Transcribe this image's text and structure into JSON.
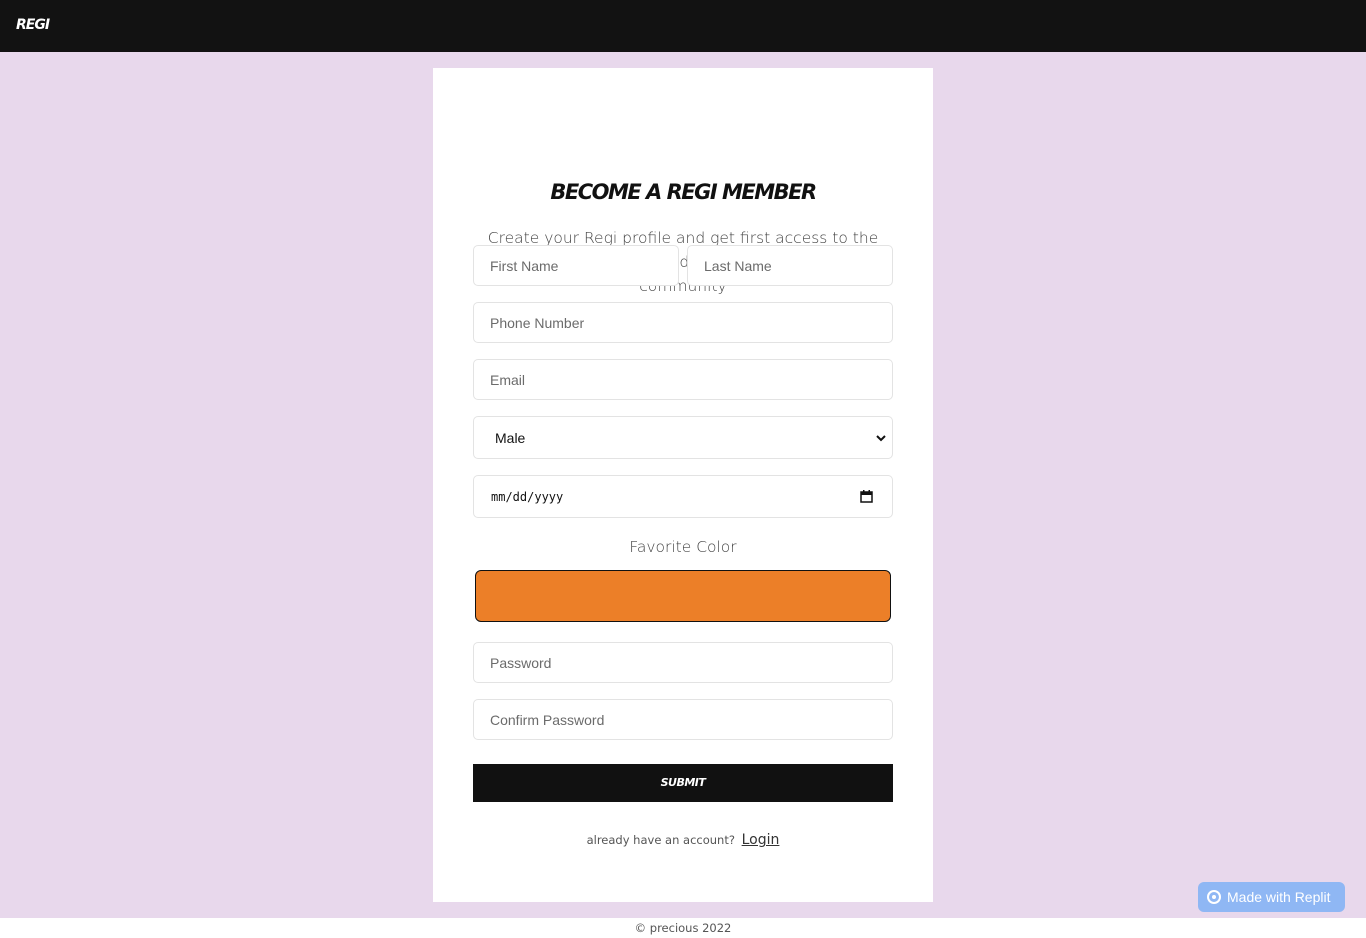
{
  "header": {
    "brand": "REGI"
  },
  "form": {
    "title": "BECOME A REGI MEMBER",
    "subtitle": "Create your Regi profile and get first access to the very best of Regi products, inspiration and community",
    "first_name_placeholder": "First Name",
    "last_name_placeholder": "Last Name",
    "phone_placeholder": "Phone Number",
    "email_placeholder": "Email",
    "gender_value": "Male",
    "date_value": "mm/dd/yyyy",
    "favorite_color_label": "Favorite Color",
    "favorite_color": "#ec7f28",
    "password_placeholder": "Password",
    "confirm_password_placeholder": "Confirm Password",
    "submit_label": "SUBMIT",
    "login_prompt": "already have an account?",
    "login_link": "Login"
  },
  "footer": {
    "text": "© precious 2022"
  },
  "badge": {
    "label": "Made with Replit"
  },
  "colors": {
    "background": "#e8d8ec",
    "topbar": "#121212",
    "submit": "#111111",
    "badge": "#8fb7f4"
  }
}
